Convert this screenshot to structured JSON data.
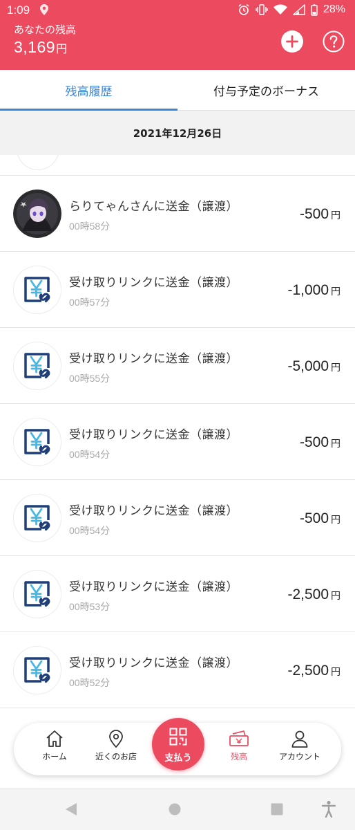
{
  "status_bar": {
    "time": "1:09",
    "battery": "28%"
  },
  "header": {
    "balance_label": "あなたの残高",
    "balance_value": "3,169",
    "balance_unit": "円"
  },
  "tabs": {
    "history": "残高履歴",
    "bonus": "付与予定のボーナス"
  },
  "date_heading": "2021年12月26日",
  "transactions": [
    {
      "title": "らりてゃんさんに送金（譲渡）",
      "time": "00時58分",
      "amount": "-500",
      "unit": "円",
      "icon": "user-avatar"
    },
    {
      "title": "受け取りリンクに送金（譲渡）",
      "time": "00時57分",
      "amount": "-1,000",
      "unit": "円",
      "icon": "yen-link-icon"
    },
    {
      "title": "受け取りリンクに送金（譲渡）",
      "time": "00時55分",
      "amount": "-5,000",
      "unit": "円",
      "icon": "yen-link-icon"
    },
    {
      "title": "受け取りリンクに送金（譲渡）",
      "time": "00時54分",
      "amount": "-500",
      "unit": "円",
      "icon": "yen-link-icon"
    },
    {
      "title": "受け取りリンクに送金（譲渡）",
      "time": "00時54分",
      "amount": "-500",
      "unit": "円",
      "icon": "yen-link-icon"
    },
    {
      "title": "受け取りリンクに送金（譲渡）",
      "time": "00時53分",
      "amount": "-2,500",
      "unit": "円",
      "icon": "yen-link-icon"
    },
    {
      "title": "受け取りリンクに送金（譲渡）",
      "time": "00時52分",
      "amount": "-2,500",
      "unit": "円",
      "icon": "yen-link-icon"
    }
  ],
  "bottom_nav": {
    "home": "ホーム",
    "nearby": "近くのお店",
    "pay": "支払う",
    "balance": "残高",
    "account": "アカウント"
  },
  "colors": {
    "brand": "#ec4a5f",
    "tab_active": "#3a84d6",
    "icon_navy": "#1f3f7a",
    "icon_cyan": "#46b8e3"
  }
}
